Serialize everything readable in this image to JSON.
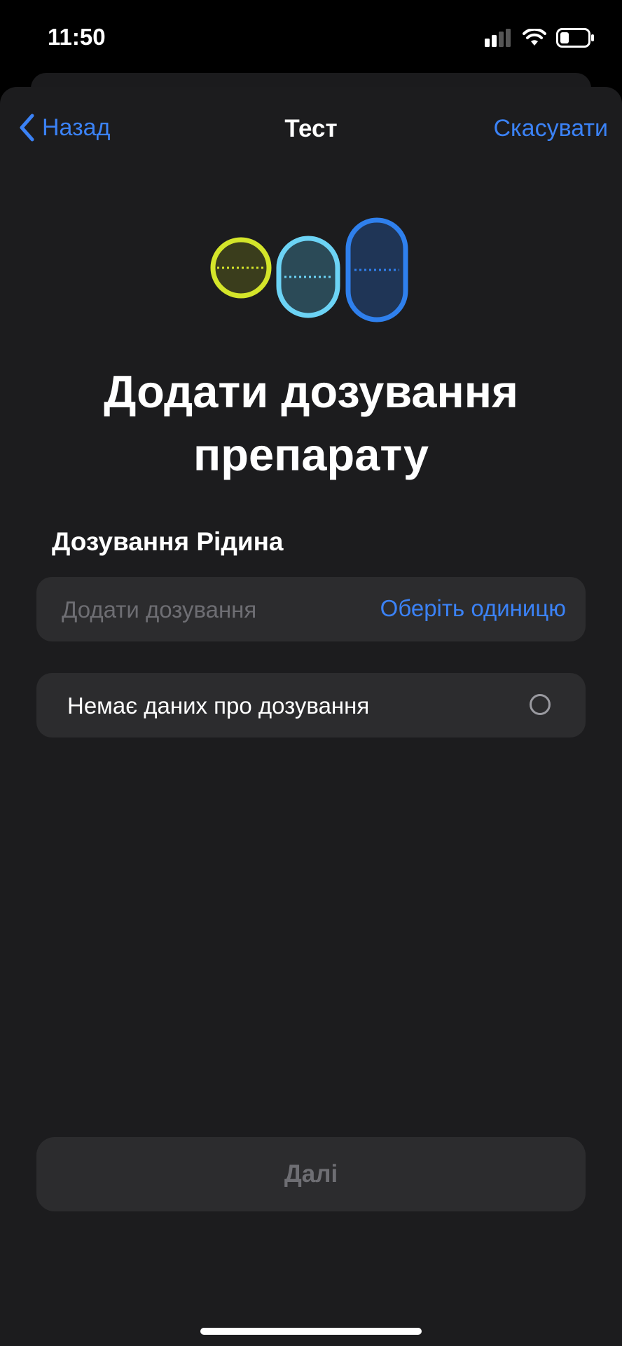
{
  "status_bar": {
    "time": "11:50"
  },
  "nav": {
    "back_label": "Назад",
    "title": "Тест",
    "cancel_label": "Скасувати"
  },
  "main": {
    "title_line1": "Додати дозування",
    "title_line2": "препарату",
    "section_label": "Дозування Рідина",
    "dosage_placeholder": "Додати дозування",
    "unit_label": "Оберіть одиницю",
    "no_data_label": "Немає даних про дозування",
    "next_label": "Далі"
  },
  "colors": {
    "accent": "#3b82f6",
    "pill_yellow": "#d4e52a",
    "pill_light_blue": "#6cd3f5",
    "pill_blue": "#2f80ed",
    "sheet": "#1c1c1e",
    "card": "#2c2c2e"
  }
}
